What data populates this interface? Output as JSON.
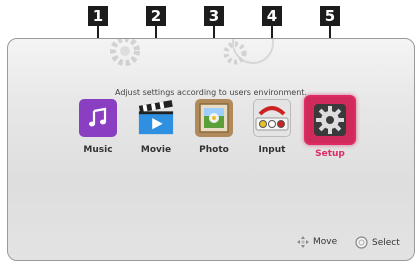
{
  "callouts": [
    "1",
    "2",
    "3",
    "4",
    "5"
  ],
  "subtitle": "Adjust settings according to users environment.",
  "menu": [
    {
      "label": "Music",
      "icon": "music-note-icon"
    },
    {
      "label": "Movie",
      "icon": "clapperboard-icon"
    },
    {
      "label": "Photo",
      "icon": "photo-frame-icon"
    },
    {
      "label": "Input",
      "icon": "rca-plug-icon"
    },
    {
      "label": "Setup",
      "icon": "gear-icon",
      "selected": true
    }
  ],
  "footer": {
    "move": "Move",
    "select": "Select"
  },
  "colors": {
    "accent": "#e02a63",
    "music": "#8a3fc2",
    "movie": "#2f8fe0",
    "photo": "#b08a5a"
  }
}
